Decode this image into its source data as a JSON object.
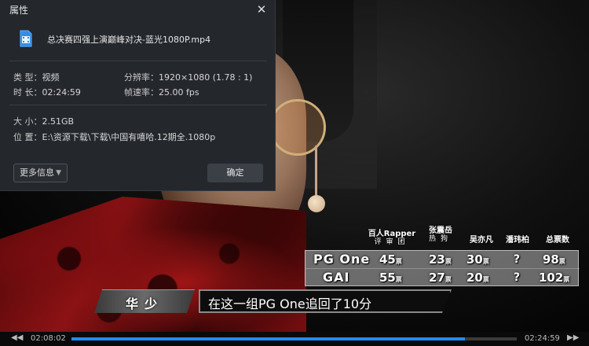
{
  "dialog": {
    "title": "属性",
    "close_glyph": "✕",
    "file_name": "总决赛四强上演巅峰对决-蓝光1080P.mp4",
    "file_icon": "video-file-icon",
    "type_label": "类 型：",
    "type_value": "视频",
    "resolution_label": "分辨率：",
    "resolution_value": "1920×1080 (1.78 : 1)",
    "duration_label": "时 长：",
    "duration_value": "02:24:59",
    "framerate_label": "帧速率：",
    "framerate_value": "25.00 fps",
    "size_label": "大 小：",
    "size_value": "2.51GB",
    "location_label": "位 置：",
    "location_value": "E:\\资源下载\\下载\\中国有嘻哈.12期全.1080p",
    "more_button": "更多信息",
    "ok_button": "确定"
  },
  "vote_overlay": {
    "col1_title": "百人Rapper",
    "col1_sub": "评审团",
    "col2_title": "张震岳",
    "col2_sub": "热狗",
    "col3_title": "吴亦凡",
    "col4_title": "潘玮柏",
    "col5_title": "总票数",
    "unit": "票",
    "rows": [
      {
        "name": "PG One",
        "v1": "45",
        "v2": "23",
        "v3": "30",
        "v4": "?",
        "total": "98"
      },
      {
        "name": "GAI",
        "v1": "55",
        "v2": "27",
        "v3": "20",
        "v4": "?",
        "total": "102"
      }
    ]
  },
  "caption": {
    "speaker": "华少",
    "text": "在这一组PG One追回了10分"
  },
  "player": {
    "current_time": "02:08:02",
    "total_time": "02:24:59",
    "progress": 0.883,
    "back_icon": "◀◀",
    "forward_icon": "▶▶",
    "accent_color": "#1d8ef0"
  }
}
